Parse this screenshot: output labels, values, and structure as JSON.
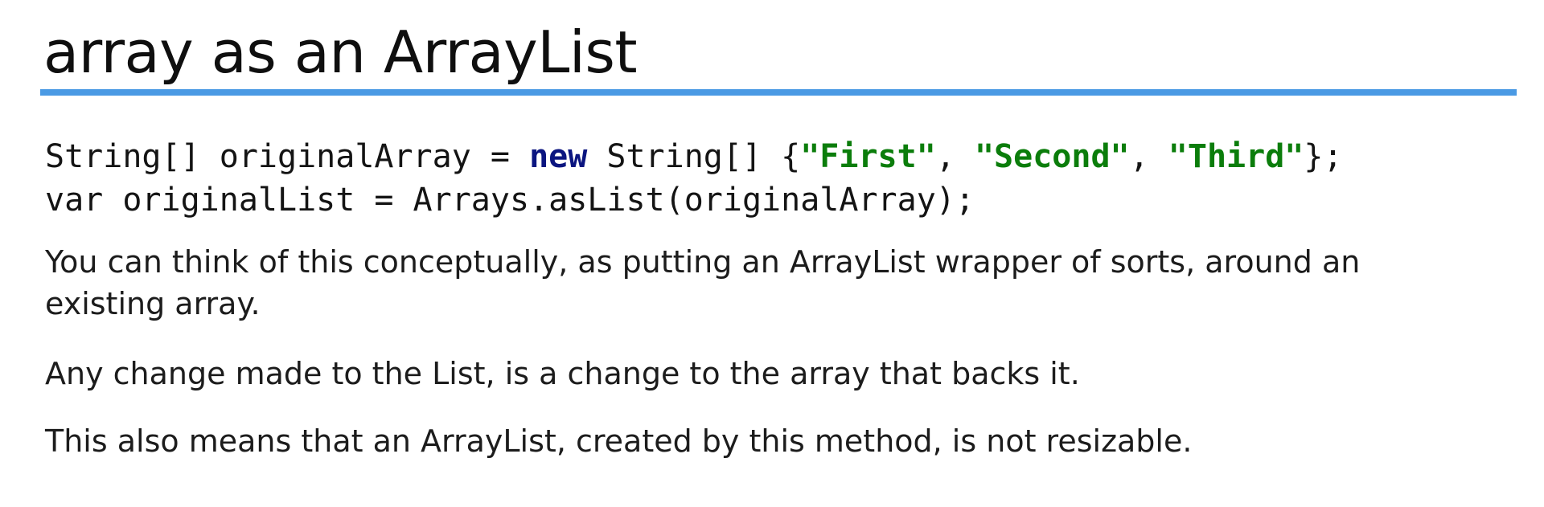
{
  "slide": {
    "title": "array as an ArrayList",
    "code": {
      "line1": {
        "part1": "String[] originalArray = ",
        "keyword": "new",
        "part2": " String[] {",
        "str1": "\"First\"",
        "sep1": ", ",
        "str2": "\"Second\"",
        "sep2": ", ",
        "str3": "\"Third\"",
        "end": "};"
      },
      "line2": "var originalList = Arrays.asList(originalArray);"
    },
    "paragraphs": [
      "You can think of this conceptually, as putting an ArrayList wrapper of sorts, around an existing array.",
      "Any change made to the List, is a change to the array that backs it.",
      "This also means that an ArrayList, created by this method, is not resizable."
    ]
  },
  "colors": {
    "title_rule": "#4a9ae4",
    "keyword": "#0b1580",
    "string": "#0b7d0b",
    "text": "#1c1c1c"
  }
}
